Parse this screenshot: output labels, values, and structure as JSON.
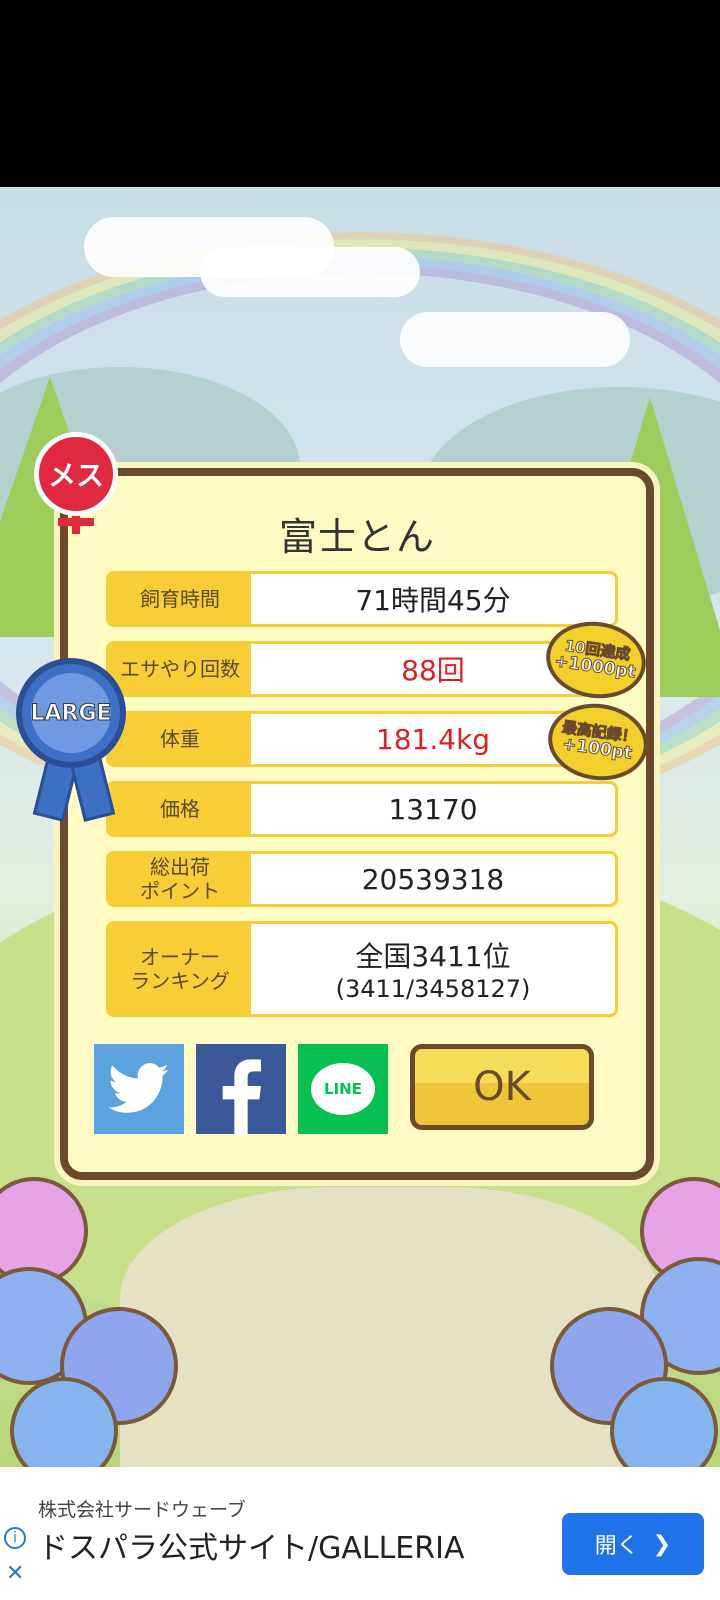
{
  "pet": {
    "name": "富士とん",
    "sex_badge": "メス",
    "size_medal": "LARGE"
  },
  "stats": [
    {
      "label": "飼育時間",
      "value": "71時間45分"
    },
    {
      "label": "エサやり回数",
      "value": "88回"
    },
    {
      "label": "体重",
      "value": "181.4kg"
    },
    {
      "label": "価格",
      "value": "13170"
    },
    {
      "label": "総出荷\nポイント",
      "value": "20539318"
    },
    {
      "label": "オーナー\nランキング",
      "value": "全国3411位",
      "sub": "(3411/3458127)"
    }
  ],
  "bonuses": [
    {
      "line1": "10回達成",
      "line2": "+1000pt"
    },
    {
      "line1": "最高記録！",
      "line2": "+100pt"
    }
  ],
  "share": {
    "line_label": "LINE"
  },
  "ok_label": "OK",
  "ad": {
    "company": "株式会社サードウェーブ",
    "headline": "ドスパラ公式サイト/GALLERIA",
    "open_label": "開く",
    "info_icon": "i",
    "close_icon": "✕"
  },
  "colors": {
    "panel_bg": "#fffbc2",
    "panel_border": "#6b4a2b",
    "label_bg": "#f9cd35",
    "highlight_red": "#e02020",
    "twitter": "#5aa3e0",
    "facebook": "#3b5998",
    "line": "#06c152",
    "ad_button": "#1e73e8"
  }
}
